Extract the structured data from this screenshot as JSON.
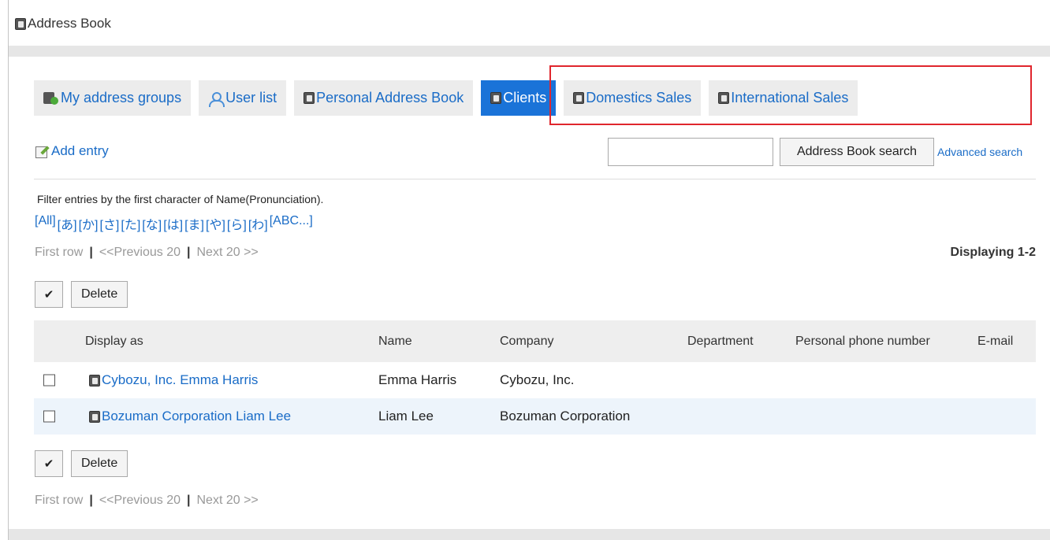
{
  "app": {
    "title": "Address Book"
  },
  "tabs": [
    {
      "label": "My address groups",
      "icon": "group-icon",
      "active": false
    },
    {
      "label": "User list",
      "icon": "user-icon",
      "active": false
    },
    {
      "label": "Personal Address Book",
      "icon": "book-icon",
      "active": false
    },
    {
      "label": "Clients",
      "icon": "book-icon",
      "active": true
    },
    {
      "label": "Domestics Sales",
      "icon": "book-icon",
      "active": false
    },
    {
      "label": "International Sales",
      "icon": "book-icon",
      "active": false
    }
  ],
  "toolbar": {
    "add_entry": "Add entry",
    "search_value": "",
    "search_button": "Address Book search",
    "advanced_search": "Advanced search"
  },
  "filter": {
    "description": "Filter entries by the first character of Name(Pronunciation).",
    "links": [
      "[All]",
      "[あ]",
      "[か]",
      "[さ]",
      "[た]",
      "[な]",
      "[は]",
      "[ま]",
      "[や]",
      "[ら]",
      "[わ]",
      "[ABC...]"
    ]
  },
  "pager": {
    "first": "First row",
    "separator": "|",
    "prev": "<<Previous 20",
    "next": "Next 20 >>",
    "displaying": "Displaying 1-2"
  },
  "actions": {
    "check": "✔",
    "delete": "Delete"
  },
  "table": {
    "headers": {
      "display_as": "Display as",
      "name": "Name",
      "company": "Company",
      "department": "Department",
      "phone": "Personal phone number",
      "email": "E-mail"
    },
    "rows": [
      {
        "display_as": "Cybozu, Inc. Emma Harris",
        "name": "Emma Harris",
        "company": "Cybozu, Inc.",
        "department": "",
        "phone": "",
        "email": ""
      },
      {
        "display_as": "Bozuman Corporation Liam Lee",
        "name": "Liam Lee",
        "company": "Bozuman Corporation",
        "department": "",
        "phone": "",
        "email": ""
      }
    ]
  },
  "colors": {
    "accent": "#1a73d8",
    "link": "#1a6cc7",
    "highlight": "#e0262d",
    "row_alt": "#edf4fb"
  }
}
